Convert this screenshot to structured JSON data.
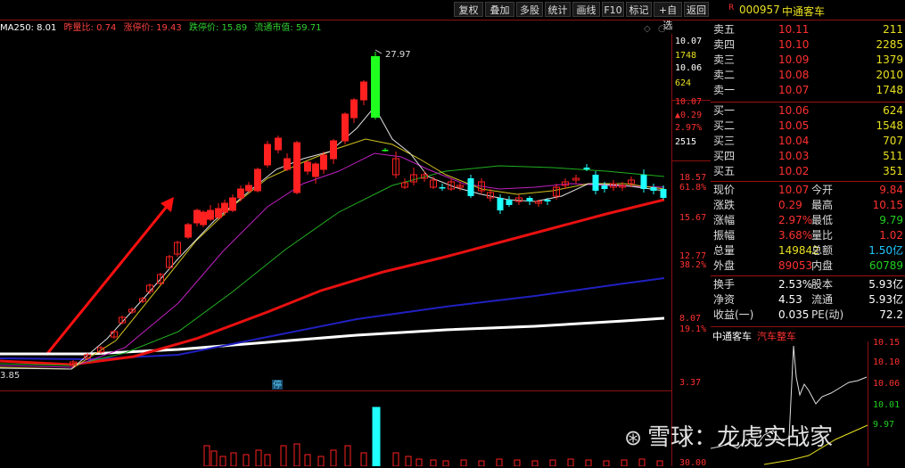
{
  "toolbar": {
    "buttons": [
      "复权",
      "叠加",
      "多股",
      "统计",
      "画线",
      "F10",
      "标记",
      "+自选",
      "返回"
    ]
  },
  "indicators": {
    "ma250": "MA250: 8.01",
    "yesterday_ratio": "昨量比: 0.74",
    "limit_up": "涨停价: 19.43",
    "limit_down": "跌停价: 15.89",
    "float_cap": "流通市值: 59.71"
  },
  "chart_annotations": {
    "high_label": "27.97",
    "low_label": "3.85",
    "suspend_badge": "停"
  },
  "price_axis": {
    "ticks": [
      "10.07",
      "1748",
      "10.06",
      "624",
      "10.07",
      "▲0.29",
      "2.97%",
      "2515",
      "18.57",
      "61.8%",
      "15.67",
      "12.77",
      "38.2%",
      "8.07",
      "19.1%",
      "3.37",
      "30.00"
    ]
  },
  "stock": {
    "badge": "R",
    "code": "000957",
    "name": "中通客车"
  },
  "order_book": {
    "asks": [
      {
        "label": "卖五",
        "price": "10.11",
        "vol": "211"
      },
      {
        "label": "卖四",
        "price": "10.10",
        "vol": "2285"
      },
      {
        "label": "卖三",
        "price": "10.09",
        "vol": "1379"
      },
      {
        "label": "卖二",
        "price": "10.08",
        "vol": "2010"
      },
      {
        "label": "卖一",
        "price": "10.07",
        "vol": "1748"
      }
    ],
    "bids": [
      {
        "label": "买一",
        "price": "10.06",
        "vol": "624"
      },
      {
        "label": "买二",
        "price": "10.05",
        "vol": "1548"
      },
      {
        "label": "买三",
        "price": "10.04",
        "vol": "707"
      },
      {
        "label": "买四",
        "price": "10.03",
        "vol": "511"
      },
      {
        "label": "买五",
        "price": "10.02",
        "vol": "351"
      }
    ]
  },
  "quote_stats": [
    {
      "l1": "现价",
      "v1": "10.07",
      "l2": "今开",
      "v2": "9.84",
      "c1": "#ff3030",
      "c2": "#ff3030"
    },
    {
      "l1": "涨跌",
      "v1": "0.29",
      "l2": "最高",
      "v2": "10.15",
      "c1": "#ff3030",
      "c2": "#ff3030"
    },
    {
      "l1": "涨幅",
      "v1": "2.97%",
      "l2": "最低",
      "v2": "9.79",
      "c1": "#ff3030",
      "c2": "#20d020"
    },
    {
      "l1": "振幅",
      "v1": "3.68%",
      "l2": "量比",
      "v2": "1.02",
      "c1": "#ff3030",
      "c2": "#ff3030"
    },
    {
      "l1": "总量",
      "v1": "149842",
      "l2": "总额",
      "v2": "1.50亿",
      "c1": "#e8e020",
      "c2": "#20c8ff"
    },
    {
      "l1": "外盘",
      "v1": "89053",
      "l2": "内盘",
      "v2": "60789",
      "c1": "#ff3030",
      "c2": "#20d020"
    }
  ],
  "fundamentals": [
    {
      "l1": "换手",
      "v1": "2.53%",
      "l2": "股本",
      "v2": "5.93亿"
    },
    {
      "l1": "净资",
      "v1": "4.53",
      "l2": "流通",
      "v2": "5.93亿"
    },
    {
      "l1": "收益(一)",
      "v1": "0.035",
      "l2": "PE(动)",
      "v2": "72.2"
    }
  ],
  "mini_chart": {
    "name": "中通客车",
    "sector": "汽车整车",
    "ticks": [
      "10.15",
      "10.10",
      "10.06",
      "10.01",
      "9.97"
    ]
  },
  "watermark": "雪球：龙虎实战家",
  "colors": {
    "up": "#ff2020",
    "down": "#20ffff",
    "bg": "#000000",
    "grid": "#8b1010"
  }
}
